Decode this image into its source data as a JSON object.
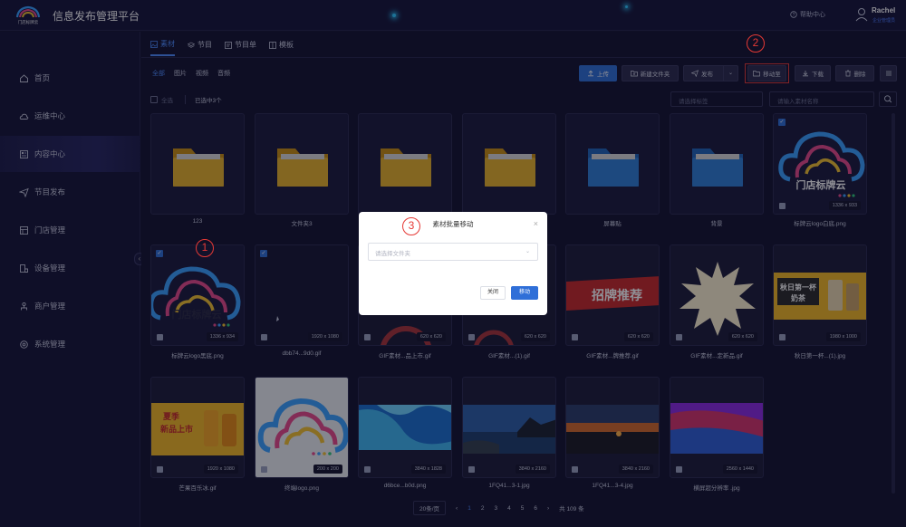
{
  "header": {
    "title": "信息发布管理平台",
    "logo_text": "门店标牌云",
    "help": "帮助中心",
    "user_name": "Rachel",
    "user_role": "企业管理员"
  },
  "sidebar": {
    "items": [
      {
        "label": "首页",
        "icon": "home-icon"
      },
      {
        "label": "运维中心",
        "icon": "cloud-icon"
      },
      {
        "label": "内容中心",
        "icon": "content-icon",
        "active": true
      },
      {
        "label": "节目发布",
        "icon": "send-icon"
      },
      {
        "label": "门店管理",
        "icon": "store-icon"
      },
      {
        "label": "设备管理",
        "icon": "device-icon"
      },
      {
        "label": "商户管理",
        "icon": "merchant-icon"
      },
      {
        "label": "系统管理",
        "icon": "settings-icon"
      }
    ]
  },
  "tabs": [
    {
      "label": "素材",
      "active": true
    },
    {
      "label": "节目"
    },
    {
      "label": "节目单"
    },
    {
      "label": "模板"
    }
  ],
  "filters": [
    {
      "label": "全部",
      "active": true
    },
    {
      "label": "图片"
    },
    {
      "label": "视频"
    },
    {
      "label": "音频"
    }
  ],
  "toolbar": {
    "upload": "上传",
    "new_folder": "新建文件夹",
    "publish": "发布",
    "move_to": "移动至",
    "download": "下载",
    "delete": "删除"
  },
  "list_bar": {
    "select_all": "全选",
    "selected": "已选中3个",
    "tag_placeholder": "请选择标签",
    "search_placeholder": "请输入素材名称"
  },
  "items": [
    {
      "name": "123",
      "type": "folder",
      "color": "#e8b22a"
    },
    {
      "name": "文件夹3",
      "type": "folder",
      "color": "#e8b22a"
    },
    {
      "name": "",
      "type": "folder",
      "color": "#e8b22a"
    },
    {
      "name": "",
      "type": "folder",
      "color": "#e8b22a"
    },
    {
      "name": "屏幕贴",
      "type": "folder",
      "color": "#2f7fd6"
    },
    {
      "name": "背景",
      "type": "folder",
      "color": "#2f7fd6"
    },
    {
      "name": "标牌云logo白底.png",
      "type": "image",
      "res": "1336 x 933",
      "checked": true,
      "logo": "门店标牌云"
    },
    {
      "name": "标牌云logo黑底.png",
      "type": "image",
      "res": "1336 x 934",
      "checked": true,
      "logo": "门店标牌云"
    },
    {
      "name": "dbb74...9d0.gif",
      "type": "image",
      "res": "1920 x 1080",
      "checked": true
    },
    {
      "name": "GIF素材...品上市.gif",
      "type": "image",
      "res": "620 x 620"
    },
    {
      "name": "GIF素材...(1).gif",
      "type": "image",
      "res": "620 x 620"
    },
    {
      "name": "GIF素材...牌推荐.gif",
      "type": "image",
      "res": "620 x 620",
      "banner": "招牌推荐"
    },
    {
      "name": "GIF素材...定新品.gif",
      "type": "image",
      "res": "620 x 620"
    },
    {
      "name": "秋日第一杯...(1).jpg",
      "type": "image",
      "res": "1980 x 1000",
      "banner": "秋日第一杯 奶茶"
    },
    {
      "name": "芒果百乐冰.gif",
      "type": "image",
      "res": "1920 x 1080",
      "banner": "夏季 新品上市"
    },
    {
      "name": "终端logo.png",
      "type": "image",
      "res": "200 x 200"
    },
    {
      "name": "d6bce...b0d.png",
      "type": "image",
      "res": "3840 x 1828"
    },
    {
      "name": "1FQ41...3-1.jpg",
      "type": "image",
      "res": "3840 x 2160"
    },
    {
      "name": "1FQ41...3-4.jpg",
      "type": "image",
      "res": "3840 x 2160"
    },
    {
      "name": "横屏超分辨率 .jpg",
      "type": "image",
      "res": "2560 x 1440"
    }
  ],
  "modal": {
    "title": "素材批量移动",
    "placeholder": "请选择文件夹",
    "cancel": "关闭",
    "confirm": "移动"
  },
  "pagination": {
    "page_size": "20条/页",
    "pages": [
      "1",
      "2",
      "3",
      "4",
      "5",
      "6"
    ],
    "current": "1",
    "total": "共 109 条"
  },
  "annotations": [
    "1",
    "2",
    "3"
  ]
}
